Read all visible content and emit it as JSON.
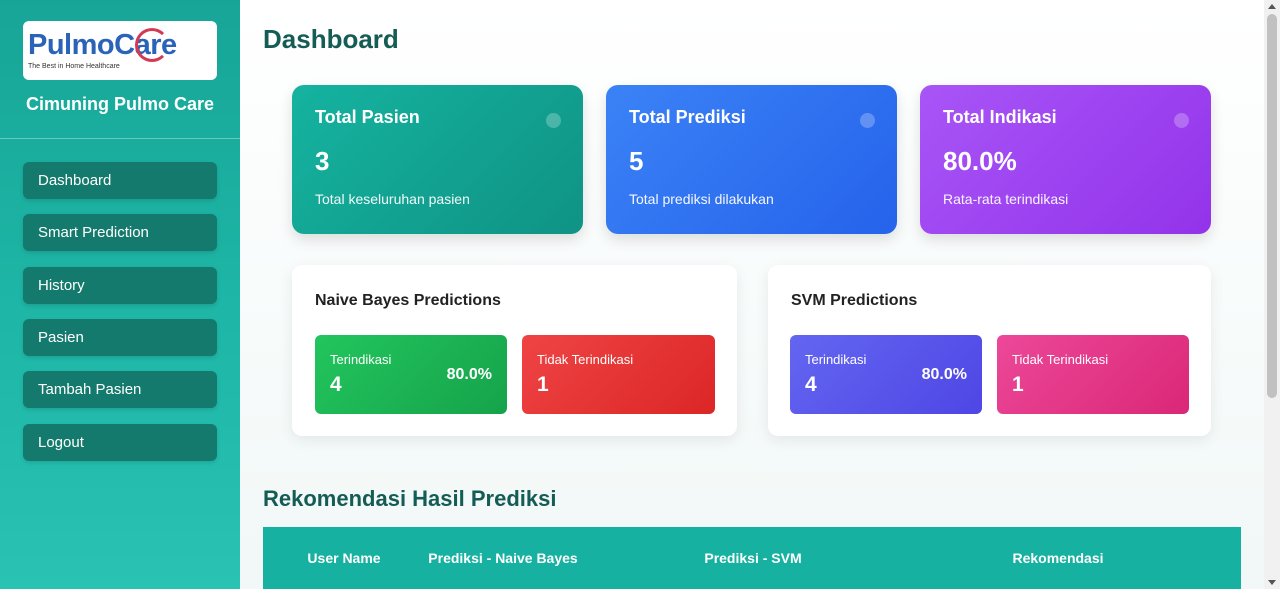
{
  "sidebar": {
    "logo": {
      "text_pulmo": "Pulmo",
      "text_care": "Care",
      "tagline": "The Best in Home Healthcare"
    },
    "brand": "Cimuning Pulmo Care",
    "nav": [
      {
        "label": "Dashboard"
      },
      {
        "label": "Smart Prediction"
      },
      {
        "label": "History"
      },
      {
        "label": "Pasien"
      },
      {
        "label": "Tambah Pasien"
      },
      {
        "label": "Logout"
      }
    ]
  },
  "main": {
    "title": "Dashboard",
    "stats": [
      {
        "title": "Total Pasien",
        "value": "3",
        "desc": "Total keseluruhan pasien",
        "color": "#15b3a0"
      },
      {
        "title": "Total Prediksi",
        "value": "5",
        "desc": "Total prediksi dilakukan",
        "color": "#3b82f6"
      },
      {
        "title": "Total Indikasi",
        "value": "80.0%",
        "desc": "Rata-rata terindikasi",
        "color": "#a855f7"
      }
    ],
    "naive_bayes": {
      "title": "Naive Bayes Predictions",
      "indicated": {
        "label": "Terindikasi",
        "value": "4",
        "percent": "80.0%"
      },
      "not_indicated": {
        "label": "Tidak Terindikasi",
        "value": "1"
      }
    },
    "svm": {
      "title": "SVM Predictions",
      "indicated": {
        "label": "Terindikasi",
        "value": "4",
        "percent": "80.0%"
      },
      "not_indicated": {
        "label": "Tidak Terindikasi",
        "value": "1"
      }
    },
    "recommendation": {
      "title": "Rekomendasi Hasil Prediksi",
      "headers": [
        "User Name",
        "Prediksi - Naive Bayes",
        "Prediksi - SVM",
        "Rekomendasi"
      ]
    }
  }
}
